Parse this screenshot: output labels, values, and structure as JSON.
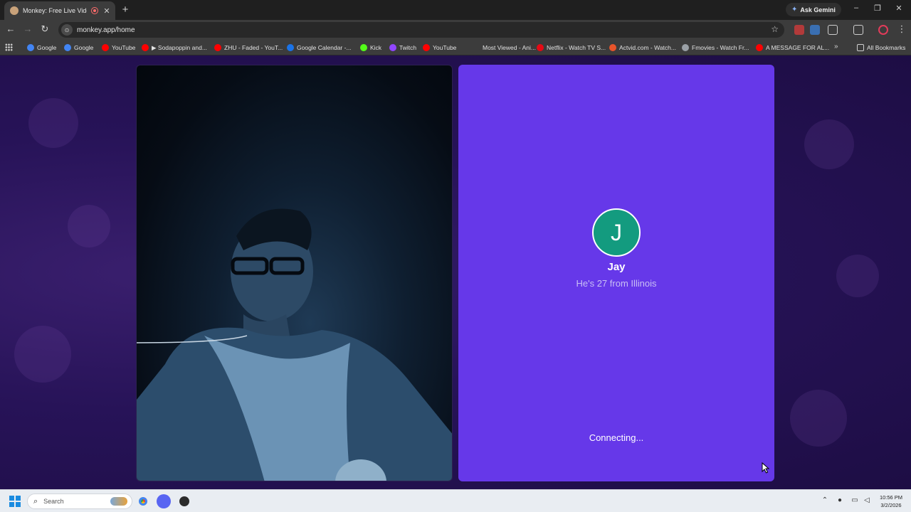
{
  "browser": {
    "tab": {
      "title": "Monkey: Free Live Video Ch",
      "close_glyph": "✕"
    },
    "new_tab_glyph": "+",
    "gemini_label": "Ask Gemini",
    "window_controls": {
      "minimize": "–",
      "restore": "❐",
      "close": "✕"
    },
    "nav": {
      "back": "←",
      "forward": "→",
      "reload": "↻"
    },
    "url": "monkey.app/home",
    "bookmarks": [
      {
        "label": "Google",
        "color": "#4285f4"
      },
      {
        "label": "Google",
        "color": "#4285f4"
      },
      {
        "label": "YouTube",
        "color": "#ff0000"
      },
      {
        "label": "▶ Sodapoppin and...",
        "color": "#ff0000"
      },
      {
        "label": "ZHU - Faded - YouT...",
        "color": "#ff0000"
      },
      {
        "label": "Google Calendar -...",
        "color": "#1a73e8"
      },
      {
        "label": "Kick",
        "color": "#53fc18"
      },
      {
        "label": "Twitch",
        "color": "#9146ff"
      },
      {
        "label": "YouTube",
        "color": "#ff0000"
      },
      {
        "label": "Most Viewed - Ani...",
        "color": "#3c3c3c"
      },
      {
        "label": "Netflix - Watch TV S...",
        "color": "#e50914"
      },
      {
        "label": "Actvid.com - Watch...",
        "color": "#e8542a"
      },
      {
        "label": "Fmovies - Watch Fr...",
        "color": "#9aa0a6"
      },
      {
        "label": "A MESSAGE FOR AL...",
        "color": "#ff0000"
      }
    ],
    "bookmarks_more": "»",
    "all_bookmarks": "All Bookmarks"
  },
  "page": {
    "peer": {
      "initial": "J",
      "name": "Jay",
      "description": "He's 27 from Illinois",
      "avatar_color": "#139b7f"
    },
    "status": "Connecting...",
    "panel_color": "#6638e9"
  },
  "taskbar": {
    "search_label": "Search",
    "time": "10:56 PM",
    "date": "3/2/2026"
  }
}
